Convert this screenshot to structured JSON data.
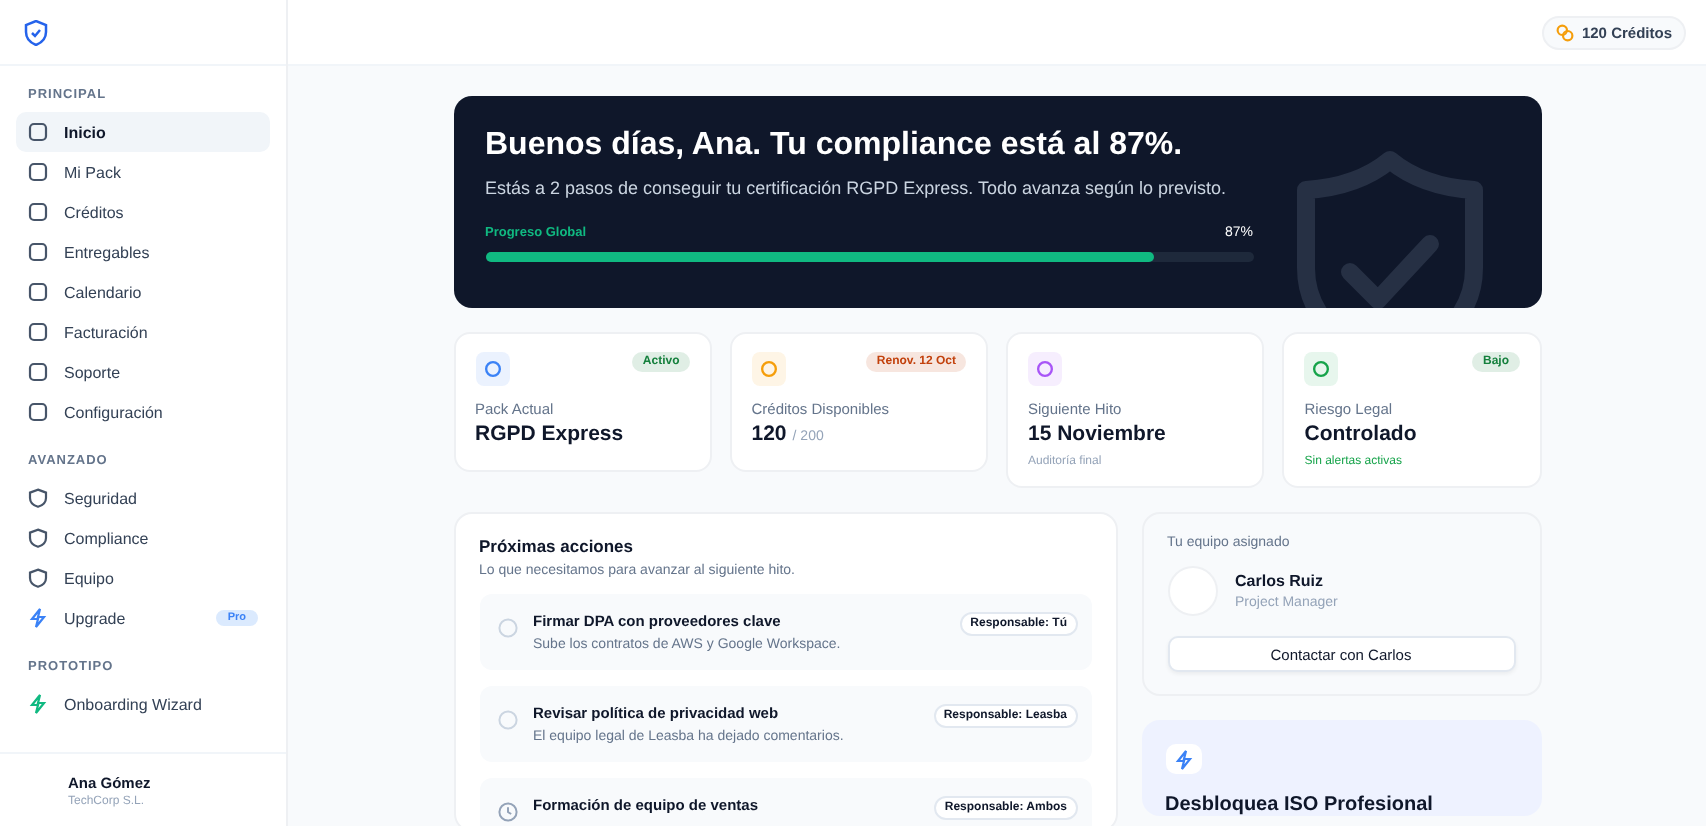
{
  "sidebar": {
    "sections": [
      {
        "title": "PRINCIPAL",
        "items": [
          {
            "label": "Inicio",
            "selected": true
          },
          {
            "label": "Mi Pack",
            "selected": false
          },
          {
            "label": "Créditos",
            "selected": false
          },
          {
            "label": "Entregables",
            "selected": false
          },
          {
            "label": "Calendario",
            "selected": false
          },
          {
            "label": "Facturación",
            "selected": false
          },
          {
            "label": "Soporte",
            "selected": false
          },
          {
            "label": "Configuración",
            "selected": false
          }
        ]
      },
      {
        "title": "AVANZADO",
        "items": [
          {
            "label": "Seguridad",
            "selected": false
          },
          {
            "label": "Compliance",
            "selected": false
          },
          {
            "label": "Equipo",
            "selected": false
          },
          {
            "label": "Upgrade",
            "selected": false,
            "badge": "Pro"
          }
        ]
      },
      {
        "title": "PROTOTIPO",
        "items": [
          {
            "label": "Onboarding Wizard",
            "selected": false
          }
        ]
      }
    ],
    "user": {
      "name": "Ana Gómez",
      "company": "TechCorp S.L."
    }
  },
  "topbar": {
    "credits": "120 Créditos"
  },
  "hero": {
    "title": "Buenos días, Ana. Tu compliance está al 87%.",
    "subtitle": "Estás a 2 pasos de conseguir tu certificación RGPD Express. Todo avanza según lo previsto.",
    "progress_label": "Progreso Global",
    "progress_reading": "87%",
    "level": 0.87
  },
  "stats": [
    {
      "label": "Pack Actual",
      "value": "RGPD Express",
      "color": "#3b82f6",
      "badge": {
        "text": "Activo",
        "color": "#15803d"
      }
    },
    {
      "label": "Créditos Disponibles",
      "value": "120",
      "suffix": "/ 200",
      "color": "#f59e0b",
      "badge": {
        "text": "Renov. 12 Oct",
        "color": "#c2410c"
      }
    },
    {
      "label": "Siguiente Hito",
      "value": "15 Noviembre",
      "color": "#a855f7",
      "note": {
        "text": "Auditoría final",
        "color": "#94a3b8"
      }
    },
    {
      "label": "Riesgo Legal",
      "value": "Controlado",
      "color": "#16a34a",
      "badge": {
        "text": "Bajo",
        "color": "#15803d"
      },
      "note": {
        "text": "Sin alertas activas",
        "color": "#16a34a"
      }
    }
  ],
  "actions": {
    "title": "Próximas acciones",
    "subtitle": "Lo que necesitamos para avanzar al siguiente hito.",
    "items": [
      {
        "kind": "todo",
        "title": "Firmar DPA con proveedores clave",
        "detail": "Sube los contratos de AWS y Google Workspace.",
        "owner": "Responsable: Tú"
      },
      {
        "kind": "todo",
        "title": "Revisar política de privacidad web",
        "detail": "El equipo legal de Leasba ha dejado comentarios.",
        "owner": "Responsable: Leasba"
      },
      {
        "kind": "scheduled",
        "title": "Formación de equipo de ventas",
        "owner": "Responsable: Ambos"
      }
    ]
  },
  "team": {
    "title": "Tu equipo asignado",
    "name": "Carlos Ruiz",
    "role": "Project Manager",
    "button": "Contactar con Carlos"
  },
  "promo": {
    "title": "Desbloquea ISO Profesional"
  }
}
